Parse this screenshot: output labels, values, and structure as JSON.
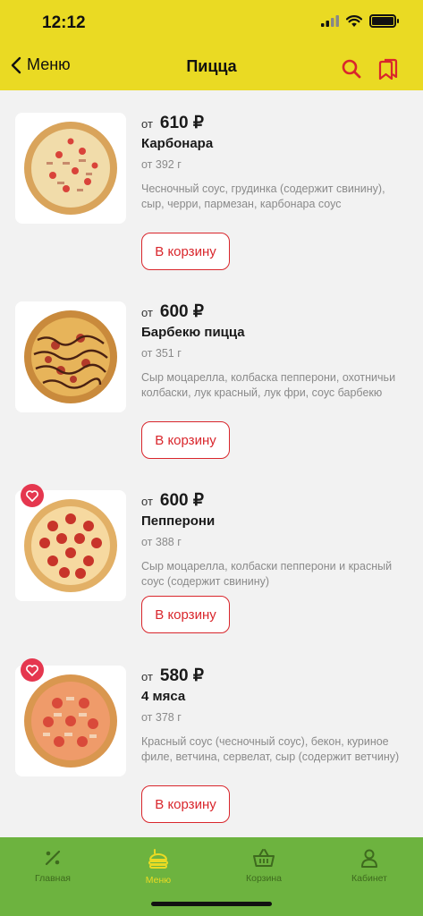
{
  "status_bar": {
    "time": "12:12"
  },
  "header": {
    "back_label": "Меню",
    "title": "Пицца"
  },
  "products": [
    {
      "price_prefix": "от",
      "price": "610 ₽",
      "name": "Карбонара",
      "weight": "от 392 г",
      "description": "Чесночный соус, грудинка (содержит свинину), сыр, черри, пармезан, карбонара соус",
      "cart_label": "В корзину",
      "favorite": false
    },
    {
      "price_prefix": "от",
      "price": "600 ₽",
      "name": "Барбекю пицца",
      "weight": "от 351 г",
      "description": "Сыр моцарелла, колбаска пепперони, охотничьи колбаски, лук красный, лук фри, соус барбекю",
      "cart_label": "В корзину",
      "favorite": false
    },
    {
      "price_prefix": "от",
      "price": "600 ₽",
      "name": "Пепперони",
      "weight": "от 388 г",
      "description": "Сыр моцарелла, колбаски пепперони и красный соус (содержит свинину)",
      "cart_label": "В корзину",
      "favorite": true
    },
    {
      "price_prefix": "от",
      "price": "580 ₽",
      "name": "4 мяса",
      "weight": "от 378 г",
      "description": "Красный соус (чесночный соус), бекон, куриное филе, ветчина, сервелат, сыр (содержит ветчину)",
      "cart_label": "В корзину",
      "favorite": true
    }
  ],
  "tabbar": {
    "items": [
      {
        "label": "Главная",
        "icon": "percent-icon",
        "active": false
      },
      {
        "label": "Меню",
        "icon": "menu-food-icon",
        "active": true
      },
      {
        "label": "Корзина",
        "icon": "basket-icon",
        "active": false
      },
      {
        "label": "Кабинет",
        "icon": "user-icon",
        "active": false
      }
    ]
  },
  "colors": {
    "header_bg": "#eada23",
    "tabbar_bg": "#6db33f",
    "accent_red": "#d9262c",
    "favorite_bg": "#e5374f"
  }
}
